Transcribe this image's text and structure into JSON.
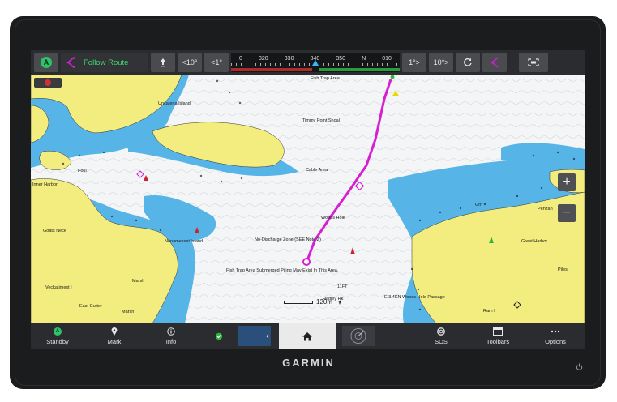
{
  "brand": "GARMIN",
  "topbar": {
    "ap_icon": "autopilot-a-icon",
    "ap_letter": "A",
    "route_icon": "route-icon",
    "route_mode": "Follow Route",
    "btn_standby_icon": "autopilot-standby-icon",
    "minus10": "<10°",
    "minus1": "<1°",
    "compass_ticks": [
      "0",
      "320",
      "330",
      "340",
      "350",
      "N",
      "010"
    ],
    "plus1": "1°>",
    "plus10": "10°>",
    "tack_icon": "circular-arrow-icon",
    "route_btn_icon": "route-icon",
    "fullscreen_icon": "fullscreen-icon",
    "heading_color": "#35b6ff"
  },
  "map": {
    "labels": {
      "uncatena": "Uncatena Island",
      "fish_trap_top": "Fish Trap Area",
      "timmy": "Timmy Point Shoal",
      "cable": "Cable Area",
      "woods_hole": "Woods Hole",
      "nonamesset": "Nonamesset Island",
      "no_discharge": "No-Discharge Zone (SEE Note Z)",
      "fish_trap_bottom": "Fish Trap Area Submerged Piling May Exist In This Area.",
      "inner_harbor": "Inner Harbor",
      "goats_neck": "Goats Neck",
      "veckatimest": "Veckatimest I",
      "east_gutter": "East Gutter",
      "marsh_1": "Marsh",
      "marsh_2": "Marsh",
      "hadley": "Hadley Rk",
      "great_harbor": "Great Harbor",
      "penzance": "Penzan",
      "woods_hole_passage": "E 3.4KN Woods Hole Passage",
      "ram": "Ram I",
      "piles": "Piles",
      "foul": "Foul",
      "grn": "Grn",
      "depth_11ft": "11FT"
    },
    "scale": "120m",
    "route_color": "#d51fd3",
    "land_color": "#f3ed7f",
    "shallow_color": "#56b4e6",
    "zoom_in": "+",
    "zoom_out": "−"
  },
  "bottombar": {
    "standby_label": "Standby",
    "standby_icon": "autopilot-a-icon",
    "mark_label": "Mark",
    "mark_icon": "map-pin-icon",
    "info_label": "Info",
    "info_icon": "info-icon",
    "home_icon": "home-icon",
    "sos_label": "SOS",
    "sos_icon": "lifebuoy-icon",
    "toolbars_label": "Toolbars",
    "toolbars_icon": "toolbar-icon",
    "options_label": "Options",
    "options_icon": "more-dots-icon"
  }
}
